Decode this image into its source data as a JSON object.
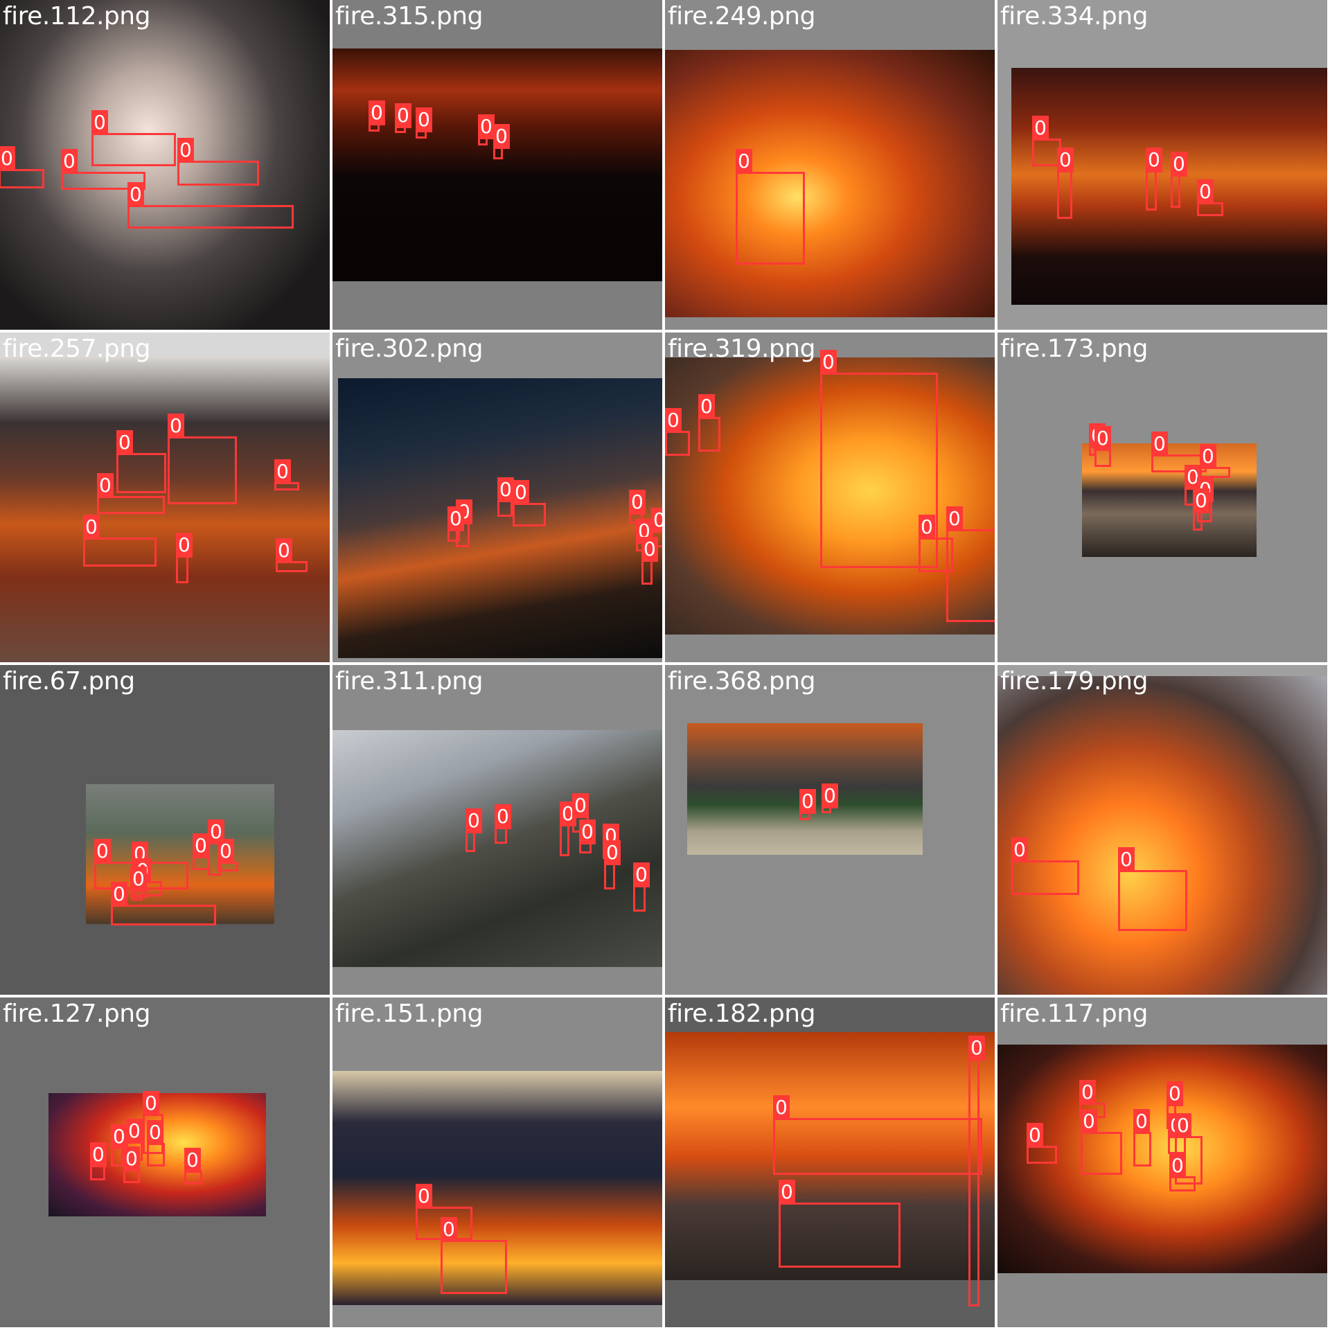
{
  "colors": {
    "box": "#ff3838",
    "label_text": "#ffffff",
    "tile_bg_dark": "#5a5a5a",
    "tile_bg_mid": "#7a7a7a",
    "tile_bg_light": "#8f8f8f"
  },
  "tiles": [
    {
      "label": "fire.112.png",
      "detections": [
        "0",
        "0",
        "0",
        "0",
        "0"
      ]
    },
    {
      "label": "fire.315.png",
      "detections": [
        "0",
        "0",
        "0",
        "0",
        "0"
      ]
    },
    {
      "label": "fire.249.png",
      "detections": [
        "0"
      ]
    },
    {
      "label": "fire.334.png",
      "detections": [
        "0",
        "0",
        "0",
        "0",
        "0"
      ]
    },
    {
      "label": "fire.257.png",
      "detections": [
        "0",
        "0",
        "0",
        "0",
        "0",
        "0",
        "0"
      ]
    },
    {
      "label": "fire.302.png",
      "detections": [
        "0",
        "0",
        "0",
        "0",
        "0",
        "0",
        "0",
        "0"
      ]
    },
    {
      "label": "fire.319.png",
      "detections": [
        "0",
        "0",
        "0",
        "0",
        "0"
      ]
    },
    {
      "label": "fire.173.png",
      "detections": [
        "0",
        "0",
        "0",
        "0",
        "0",
        "0",
        "0"
      ]
    },
    {
      "label": "fire.67.png",
      "detections": [
        "0",
        "0",
        "0",
        "0",
        "0",
        "0",
        "0",
        "0"
      ]
    },
    {
      "label": "fire.311.png",
      "detections": [
        "0",
        "0",
        "0",
        "0",
        "0",
        "0",
        "0",
        "0"
      ]
    },
    {
      "label": "fire.368.png",
      "detections": [
        "0",
        "0"
      ]
    },
    {
      "label": "fire.179.png",
      "detections": [
        "0",
        "0"
      ]
    },
    {
      "label": "fire.127.png",
      "detections": [
        "0",
        "0",
        "0",
        "0",
        "0",
        "0",
        "0"
      ]
    },
    {
      "label": "fire.151.png",
      "detections": [
        "0",
        "0"
      ]
    },
    {
      "label": "fire.182.png",
      "detections": [
        "0",
        "0",
        "0"
      ]
    },
    {
      "label": "fire.117.png",
      "detections": [
        "0",
        "0",
        "0",
        "0",
        "0",
        "0",
        "0",
        "0"
      ]
    }
  ]
}
